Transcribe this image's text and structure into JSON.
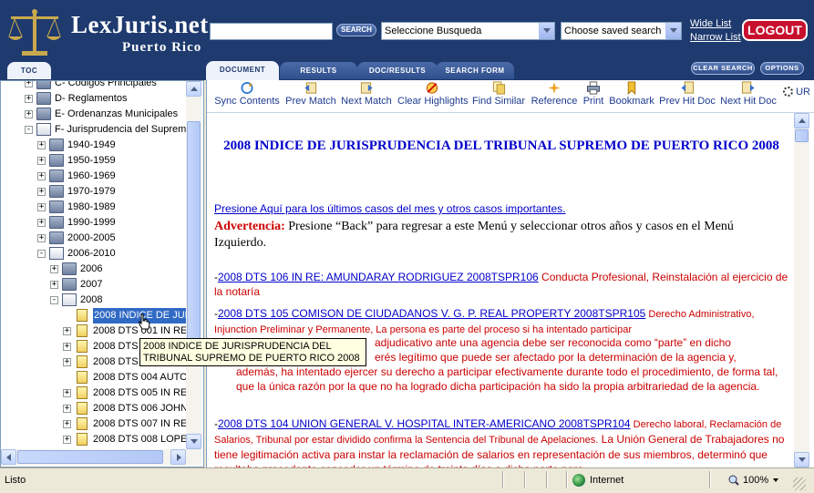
{
  "header": {
    "logo_title": "LexJuris.net",
    "logo_subtitle": "Puerto Rico",
    "search_value": "",
    "search_button": "SEARCH",
    "search_type_combo": "Seleccione Busqueda",
    "saved_search_combo": "Choose saved search",
    "wide_list": "Wide List",
    "narrow_list": "Narrow List",
    "logout": "LOGOUT"
  },
  "tabs": {
    "toc": "TOC",
    "document": "DOCUMENT",
    "results": "RESULTS",
    "doc_results": "DOC/RESULTS",
    "search_form": "SEARCH FORM",
    "clear_search": "CLEAR SEARCH",
    "options": "OPTIONS"
  },
  "toc": {
    "items": [
      {
        "label": "C- Codigos Principales"
      },
      {
        "label": "D- Reglamentos"
      },
      {
        "label": "E- Ordenanzas Municipales"
      },
      {
        "label": "F- Jurisprudencia del Supremo"
      },
      {
        "label": "1940-1949"
      },
      {
        "label": "1950-1959"
      },
      {
        "label": "1960-1969"
      },
      {
        "label": "1970-1979"
      },
      {
        "label": "1980-1989"
      },
      {
        "label": "1990-1999"
      },
      {
        "label": "2000-2005"
      },
      {
        "label": "2006-2010"
      },
      {
        "label": "2006"
      },
      {
        "label": "2007"
      },
      {
        "label": "2008"
      },
      {
        "label": "2008 INDICE DE JUR"
      },
      {
        "label": "2008 DTS 001 IN RE"
      },
      {
        "label": "2008 DTS 002"
      },
      {
        "label": "2008 DTS 003 MELE"
      },
      {
        "label": "2008 DTS 004 AUTO"
      },
      {
        "label": "2008 DTS 005 IN RE"
      },
      {
        "label": "2008 DTS 006 JOHN"
      },
      {
        "label": "2008 DTS 007 IN RE"
      },
      {
        "label": "2008 DTS 008 LOPE"
      }
    ],
    "tooltip": "2008 INDICE DE JURISPRUDENCIA DEL TRIBUNAL SUPREMO DE PUERTO RICO 2008"
  },
  "toolbar": {
    "sync_contents": "Sync Contents",
    "prev_match": "Prev Match",
    "next_match": "Next Match",
    "clear_highlights": "Clear Highlights",
    "find_similar": "Find Similar",
    "reference": "Reference",
    "print": "Print",
    "bookmark": "Bookmark",
    "prev_hit_doc": "Prev Hit Doc",
    "next_hit_doc": "Next Hit Doc",
    "url": "UR"
  },
  "document": {
    "title": "2008 INDICE DE JURISPRUDENCIA DEL TRIBUNAL SUPREMO DE PUERTO RICO 2008",
    "recent_link": "Presione Aquí para los últimos casos del mes y otros casos importantes.",
    "warning_label": "Advertencia:",
    "warning_text": " Presione “Back” para regresar a este Menú y seleccionar otros años y casos en el Menú Izquierdo.",
    "cases": [
      {
        "link": "2008 DTS 106 IN RE: AMUNDARAY RODRIGUEZ 2008TSPR106",
        "summary": " Conducta Profesional, Reinstalación al ejercicio de la notaría"
      },
      {
        "link": "2008 DTS 105 COMISON DE CIUDADANOS V. G. P. REAL PROPERTY 2008TSPR105",
        "summary_small": " Derecho Administrativo, Injunction Preliminar y Permanente, La persona es parte del proceso si ha intentado participar",
        "summary_cont": "adjudicativo ante una agencia debe ser reconocida como “parte” en dicho",
        "summary_cont2": "erés legítimo que puede ser afectado por la determinación de la agencia y,",
        "summary_cont3": "además, ha intentado ejercer su derecho a participar efectivamente durante todo el procedimiento, de forma tal, que la única razón por la que no ha logrado dicha participación ha sido la propia arbitrariedad de la agencia."
      },
      {
        "link": "2008 DTS 104 UNION GENERAL V. HOSPITAL INTER-AMERICANO 2008TSPR104",
        "summary_small": " Derecho laboral, Reclamación de Salarios, Tribunal por estar dividido confirma la Sentencia del Tribunal de  Apelaciones.",
        "summary_cont": " La Unión General de Trabajadores no tiene legitimación activa para instar la reclamación de salarios en representación de sus miembros, determinó que resultaba procedente conceder un término de treinta días a dicha parte para"
      }
    ]
  },
  "statusbar": {
    "status": "Listo",
    "zone": "Internet",
    "zoom": "100%"
  }
}
